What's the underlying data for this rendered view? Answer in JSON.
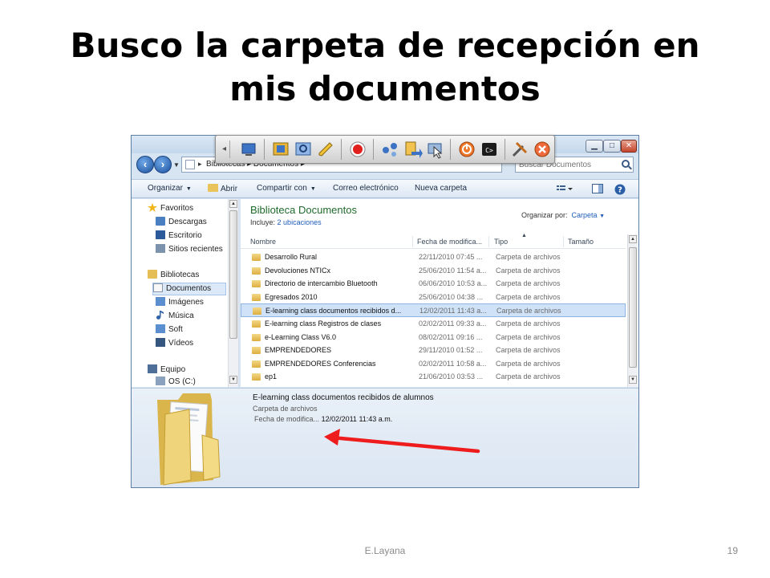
{
  "slide": {
    "title": "Busco la carpeta de recepción en mis documentos",
    "author": "E.Layana",
    "page_number": "19"
  },
  "address_bar": {
    "breadcrumb": "Bibliotecas ▸ Documentos ▸",
    "search_placeholder": "Buscar Documentos"
  },
  "command_bar": {
    "organize": "Organizar",
    "open": "Abrir",
    "share": "Compartir con",
    "email": "Correo electrónico",
    "new_folder": "Nueva carpeta"
  },
  "nav_pane": {
    "favorites": "Favoritos",
    "downloads": "Descargas",
    "desktop": "Escritorio",
    "recent": "Sitios recientes",
    "libraries": "Bibliotecas",
    "documents": "Documentos",
    "images": "Imágenes",
    "music": "Música",
    "soft": "Soft",
    "videos": "Vídeos",
    "computer": "Equipo",
    "drive": "OS (C:)"
  },
  "library": {
    "title": "Biblioteca Documentos",
    "includes_label": "Incluye:",
    "includes_value": "2 ubicaciones",
    "arrange_label": "Organizar por:",
    "arrange_value": "Carpeta"
  },
  "columns": {
    "name": "Nombre",
    "date": "Fecha de modifica...",
    "type": "Tipo",
    "size": "Tamaño"
  },
  "rows": [
    {
      "name": "Desarrollo Rural",
      "date": "22/11/2010 07:45 ...",
      "type": "Carpeta de archivos"
    },
    {
      "name": "Devoluciones NTICx",
      "date": "25/06/2010 11:54 a...",
      "type": "Carpeta de archivos"
    },
    {
      "name": "Directorio de intercambio Bluetooth",
      "date": "06/06/2010 10:53 a...",
      "type": "Carpeta de archivos"
    },
    {
      "name": "Egresados 2010",
      "date": "25/06/2010 04:38 ...",
      "type": "Carpeta de archivos"
    },
    {
      "name": "E-learning class documentos recibidos d...",
      "date": "12/02/2011 11:43 a...",
      "type": "Carpeta de archivos"
    },
    {
      "name": "E-learning class Registros de clases",
      "date": "02/02/2011 09:33 a...",
      "type": "Carpeta de archivos"
    },
    {
      "name": "e-Learning Class V6.0",
      "date": "08/02/2011 09:16 ...",
      "type": "Carpeta de archivos"
    },
    {
      "name": "EMPRENDEDORES",
      "date": "29/11/2010 01:52 ...",
      "type": "Carpeta de archivos"
    },
    {
      "name": "EMPRENDEDORES Conferencias",
      "date": "02/02/2011 10:58 a...",
      "type": "Carpeta de archivos"
    },
    {
      "name": "ep1",
      "date": "21/06/2010 03:53 ...",
      "type": "Carpeta de archivos"
    }
  ],
  "details": {
    "name": "E-learning class documentos recibidos de alumnos",
    "type": "Carpeta de archivos",
    "date_label": "Fecha de modifica...",
    "date_value": "12/02/2011 11:43 a.m."
  },
  "colors": {
    "annotation_arrow": "#ee1c1c",
    "library_title": "#1e6b2b",
    "link_blue": "#1f5db9",
    "selection": "#cfe2f8"
  }
}
